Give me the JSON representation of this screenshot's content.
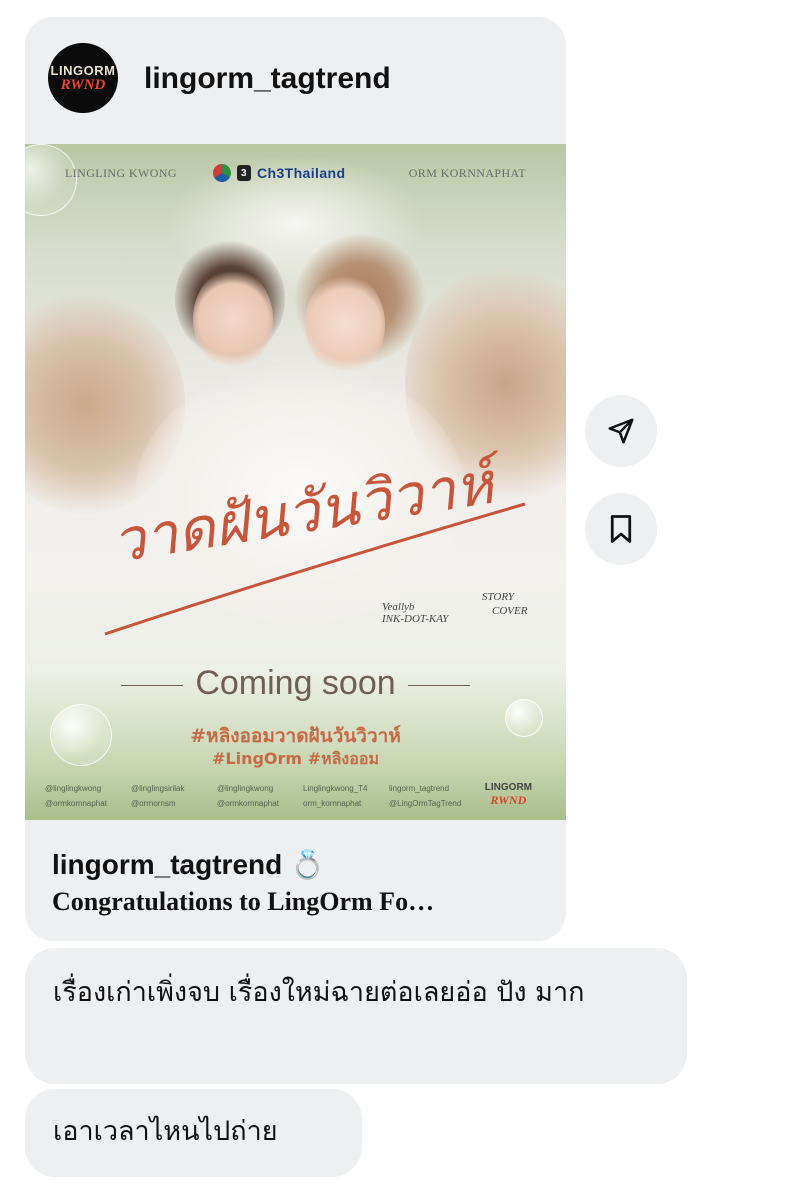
{
  "post": {
    "username": "lingorm_tagtrend",
    "avatar_text": {
      "line1": "LINGORM",
      "line2": "RWND"
    },
    "poster": {
      "top_left_name": "LINGLING KWONG",
      "channel_label": "Ch3Thailand",
      "channel_badge": "3",
      "top_right_name": "ORM KORNNAPHAT",
      "title_thai": "วาดฝันวันวิวาห์",
      "credits": [
        "Veallyb",
        "INK-DOT-KAY",
        "STORY",
        "COVER"
      ],
      "coming_soon": "Coming soon",
      "hashtag_main": "#หลิงออมวาดฝันวันวิวาห์",
      "hashtag_sub": "#LingOrm #หลิงออม",
      "handles": [
        "@linglingkwong",
        "@linglingsirilak",
        "@linglingkwong",
        "Linglingkwong_T4",
        "lingorm_tagtrend",
        "@ormkornnaphat",
        "@orrnornsm",
        "@ormkornnaphat",
        "orm_kornnaphat",
        "@LingOrmTagTrend"
      ],
      "brand": {
        "line1": "LINGORM",
        "line2": "RWND"
      }
    },
    "caption_user": "lingorm_tagtrend 💍",
    "caption_text": "Congratulations to LingOrm Fo…"
  },
  "messages": [
    {
      "text": "เรื่องเก่าเพิ่งจบ เรื่องใหม่ฉายต่อเลยอ่อ ปัง มาก"
    },
    {
      "text": "เอาเวลาไหนไปถ่าย"
    }
  ],
  "actions": {
    "share_icon": "send-icon",
    "save_icon": "bookmark-icon"
  },
  "colors": {
    "bubble": "#eeeff1",
    "accent_text": "#c56a47",
    "title_script": "#c6553b"
  }
}
